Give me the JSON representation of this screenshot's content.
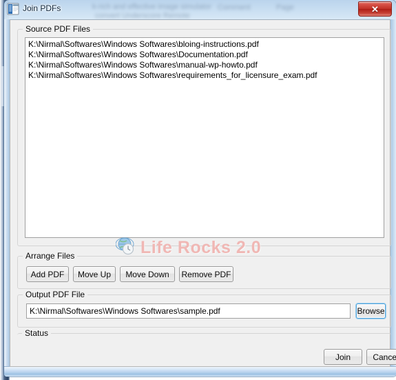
{
  "window": {
    "title": "Join PDFs",
    "icon": "pdf-app-icon",
    "close_label": "✕",
    "ghost_text_1": "k-rich and effective image simulator",
    "ghost_text_2": "convert Underscore Remote",
    "ghost_text_3": "Comment",
    "ghost_text_4": "Page"
  },
  "source_group": {
    "label": "Source PDF Files",
    "files": [
      "K:\\Nirmal\\Softwares\\Windows Softwares\\bloing-instructions.pdf",
      "K:\\Nirmal\\Softwares\\Windows Softwares\\Documentation.pdf",
      "K:\\Nirmal\\Softwares\\Windows Softwares\\manual-wp-howto.pdf",
      "K:\\Nirmal\\Softwares\\Windows Softwares\\requirements_for_licensure_exam.pdf"
    ]
  },
  "arrange_group": {
    "label": "Arrange Files",
    "buttons": [
      {
        "label": "Add PDF"
      },
      {
        "label": "Move Up"
      },
      {
        "label": "Move Down"
      },
      {
        "label": "Remove PDF"
      }
    ]
  },
  "output_group": {
    "label": "Output PDF File",
    "value": "K:\\Nirmal\\Softwares\\Windows Softwares\\sample.pdf",
    "placeholder": "",
    "browse_label": "Browse"
  },
  "status_group": {
    "label": "Status",
    "text": ""
  },
  "footer": {
    "join_label": "Join",
    "cancel_label": "Cancel"
  },
  "watermark": {
    "text": "Life Rocks 2.0",
    "icon": "globe-clock-icon",
    "color": "#f0b7b4"
  },
  "colors": {
    "accent": "#4ea0d8",
    "close_button": "#c13228",
    "client_bg": "#f0f0f0",
    "field_bg": "#ffffff"
  }
}
